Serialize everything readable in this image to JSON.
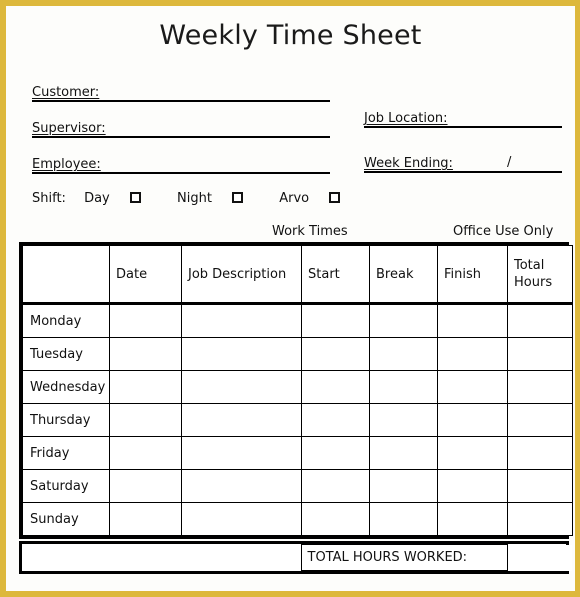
{
  "document": {
    "title": "Weekly Time Sheet",
    "frame_color": "#ddb83c",
    "paper_color": "#fdfdfb",
    "ink_color": "#111111"
  },
  "fields": {
    "customer": {
      "label": "Customer:",
      "value": ""
    },
    "supervisor": {
      "label": "Supervisor:",
      "value": ""
    },
    "employee": {
      "label": "Employee:",
      "value": ""
    },
    "job_location": {
      "label": "Job Location:",
      "value": ""
    },
    "week_ending": {
      "label": "Week Ending:",
      "value": "/"
    }
  },
  "shift": {
    "label": "Shift:",
    "options": [
      {
        "name": "Day",
        "checked": false
      },
      {
        "name": "Night",
        "checked": false
      },
      {
        "name": "Arvo",
        "checked": false
      }
    ]
  },
  "section_captions": {
    "work_times": "Work Times",
    "office_use_only": "Office Use Only"
  },
  "table": {
    "columns": [
      {
        "key": "day",
        "header": ""
      },
      {
        "key": "date",
        "header": "Date"
      },
      {
        "key": "desc",
        "header": "Job Description"
      },
      {
        "key": "start",
        "header": "Start"
      },
      {
        "key": "break",
        "header": "Break"
      },
      {
        "key": "finish",
        "header": "Finish"
      },
      {
        "key": "total",
        "header": "Total Hours"
      }
    ],
    "rows": [
      {
        "day": "Monday",
        "date": "",
        "desc": "",
        "start": "",
        "break": "",
        "finish": "",
        "total": ""
      },
      {
        "day": "Tuesday",
        "date": "",
        "desc": "",
        "start": "",
        "break": "",
        "finish": "",
        "total": ""
      },
      {
        "day": "Wednesday",
        "date": "",
        "desc": "",
        "start": "",
        "break": "",
        "finish": "",
        "total": ""
      },
      {
        "day": "Thursday",
        "date": "",
        "desc": "",
        "start": "",
        "break": "",
        "finish": "",
        "total": ""
      },
      {
        "day": "Friday",
        "date": "",
        "desc": "",
        "start": "",
        "break": "",
        "finish": "",
        "total": ""
      },
      {
        "day": "Saturday",
        "date": "",
        "desc": "",
        "start": "",
        "break": "",
        "finish": "",
        "total": ""
      },
      {
        "day": "Sunday",
        "date": "",
        "desc": "",
        "start": "",
        "break": "",
        "finish": "",
        "total": ""
      }
    ]
  },
  "footer": {
    "watermark": "",
    "total_label": "TOTAL HOURS WORKED:",
    "total_value": ""
  }
}
